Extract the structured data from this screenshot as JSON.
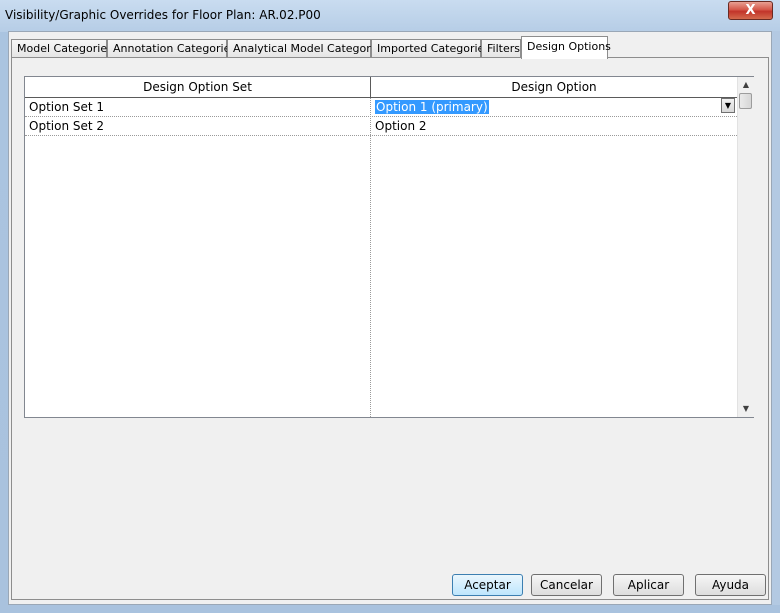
{
  "window": {
    "title": "Visibility/Graphic Overrides for Floor Plan: AR.02.P00",
    "close_label": "X"
  },
  "tabs": [
    {
      "label": "Model Categories",
      "active": false
    },
    {
      "label": "Annotation Categories",
      "active": false
    },
    {
      "label": "Analytical Model Categories",
      "active": false
    },
    {
      "label": "Imported Categories",
      "active": false
    },
    {
      "label": "Filters",
      "active": false
    },
    {
      "label": "Design Options",
      "active": true
    }
  ],
  "grid": {
    "columns": [
      "Design Option Set",
      "Design Option"
    ],
    "rows": [
      {
        "set": "Option Set 1",
        "option": "Option 1 (primary)",
        "selected": true
      },
      {
        "set": "Option Set 2",
        "option": "Option 2",
        "selected": false
      }
    ],
    "dropdown_icon": "chevron-down-icon",
    "scroll_up_icon": "scroll-up-icon",
    "scroll_down_icon": "scroll-down-icon"
  },
  "buttons": {
    "ok": "Aceptar",
    "cancel": "Cancelar",
    "apply": "Aplicar",
    "help": "Ayuda"
  },
  "colors": {
    "selection": "#3399ff",
    "close_button": "#c2342a"
  }
}
